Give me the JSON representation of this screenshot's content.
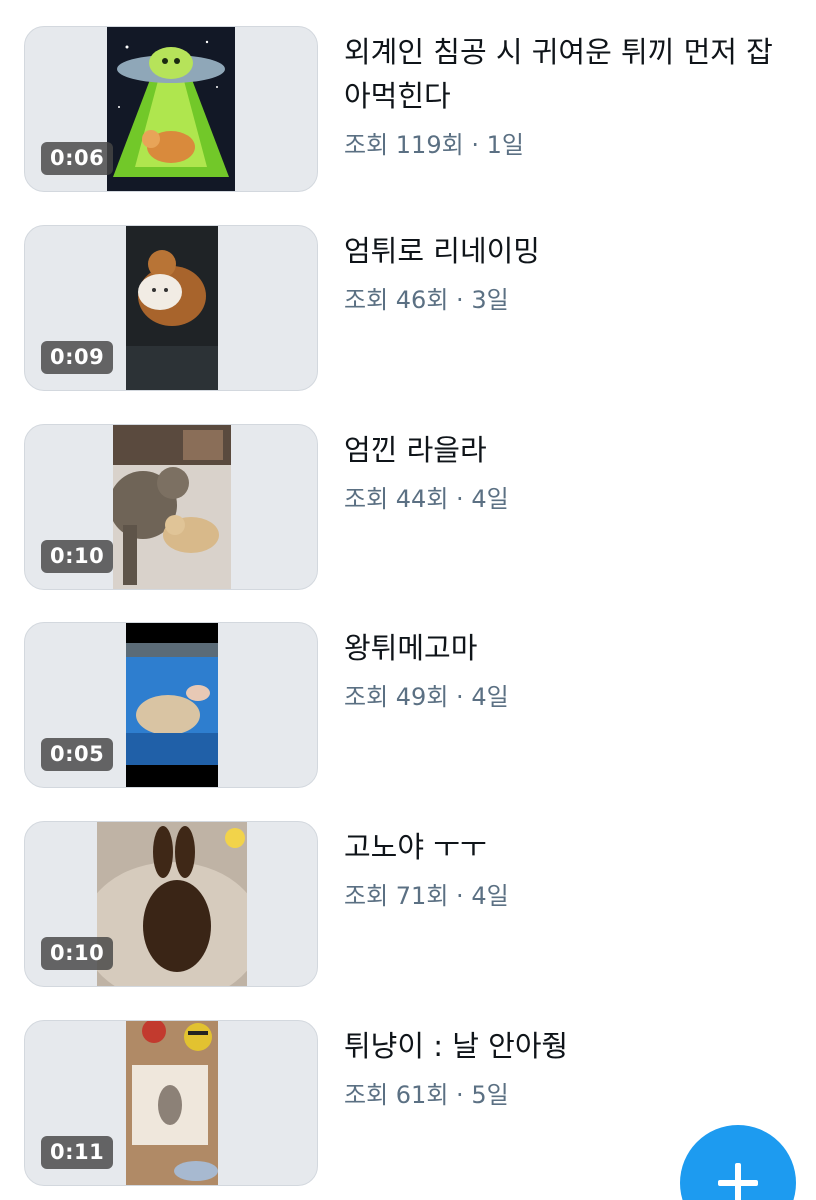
{
  "videos": [
    {
      "title": "외계인 침공 시 귀여운 튀끼 먼저 잡아먹힌다",
      "views": "조회 119회",
      "age": "1일",
      "duration": "0:06",
      "thumbnail_icon": "ufo-hamster-thumbnail-icon"
    },
    {
      "title": "엄튀로 리네이밍",
      "views": "조회 46회",
      "age": "3일",
      "duration": "0:09",
      "thumbnail_icon": "cat-with-plush-thumbnail-icon"
    },
    {
      "title": "엄낀 라을라",
      "views": "조회 44회",
      "age": "4일",
      "duration": "0:10",
      "thumbnail_icon": "cat-and-rabbit-thumbnail-icon"
    },
    {
      "title": "왕튀메고마",
      "views": "조회 49회",
      "age": "4일",
      "duration": "0:05",
      "thumbnail_icon": "rabbit-in-pen-thumbnail-icon"
    },
    {
      "title": "고노야 ㅜㅜ",
      "views": "조회 71회",
      "age": "4일",
      "duration": "0:10",
      "thumbnail_icon": "brown-rabbit-thumbnail-icon"
    },
    {
      "title": "튀냥이 : 날 안아줭",
      "views": "조회 61회",
      "age": "5일",
      "duration": "0:11",
      "thumbnail_icon": "cat-on-rug-thumbnail-icon"
    }
  ],
  "fab": {
    "icon": "plus-icon",
    "color": "#1d9bf0"
  }
}
